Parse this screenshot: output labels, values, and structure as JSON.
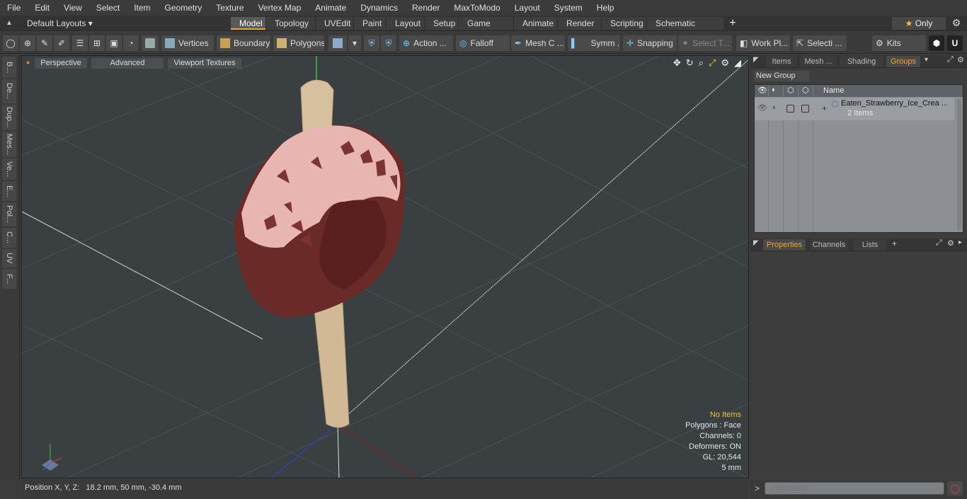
{
  "menu": [
    "File",
    "Edit",
    "View",
    "Select",
    "Item",
    "Geometry",
    "Texture",
    "Vertex Map",
    "Animate",
    "Dynamics",
    "Render",
    "MaxToModo",
    "Layout",
    "System",
    "Help"
  ],
  "layouts": {
    "dropdown": "Default Layouts",
    "tabs": [
      "Model",
      "Topology",
      "UVEdit",
      "Paint",
      "Layout",
      "Setup",
      "Game Tools",
      "Animate",
      "Render",
      "Scripting",
      "Schematic Fusion"
    ],
    "active": "Model",
    "only_label": "Only"
  },
  "toolbar": {
    "vertices": "Vertices",
    "boundary": "Boundary",
    "polygons": "Polygons",
    "action": "Action ...",
    "falloff": "Falloff",
    "mesh": "Mesh C ...",
    "symm": "Symm ...",
    "snapping": "Snapping",
    "select_t": "Select T...",
    "workpl": "Work Pl...",
    "selecti": "Selecti ...",
    "kits": "Kits"
  },
  "left_tabs": [
    "B...",
    "De...",
    "Dup...",
    "Mes...",
    "Ve...",
    "E...",
    "Pol...",
    "C...",
    "UV",
    "F..."
  ],
  "viewport": {
    "perspective": "Perspective",
    "advanced": "Advanced",
    "textures": "Viewport Textures",
    "info": {
      "no_items": "No Items",
      "polygons": "Polygons : Face",
      "channels": "Channels: 0",
      "deformers": "Deformers: ON",
      "gl": "GL: 20,544",
      "scale": "5 mm"
    }
  },
  "status": {
    "position": "Position X, Y, Z:   18.2 mm, 50 mm, -30.4 mm"
  },
  "right_panel": {
    "top_tabs": [
      "Items",
      "Mesh ...",
      "Shading",
      "Groups"
    ],
    "active_top": "Groups",
    "new_group": "New Group",
    "name_header": "Name",
    "group_name": "Eaten_Strawberry_Ice_Crea ...",
    "group_count": "2 Items",
    "bottom_tabs": [
      "Properties",
      "Channels",
      "Lists"
    ],
    "active_bottom": "Properties",
    "command_placeholder": "Command"
  }
}
